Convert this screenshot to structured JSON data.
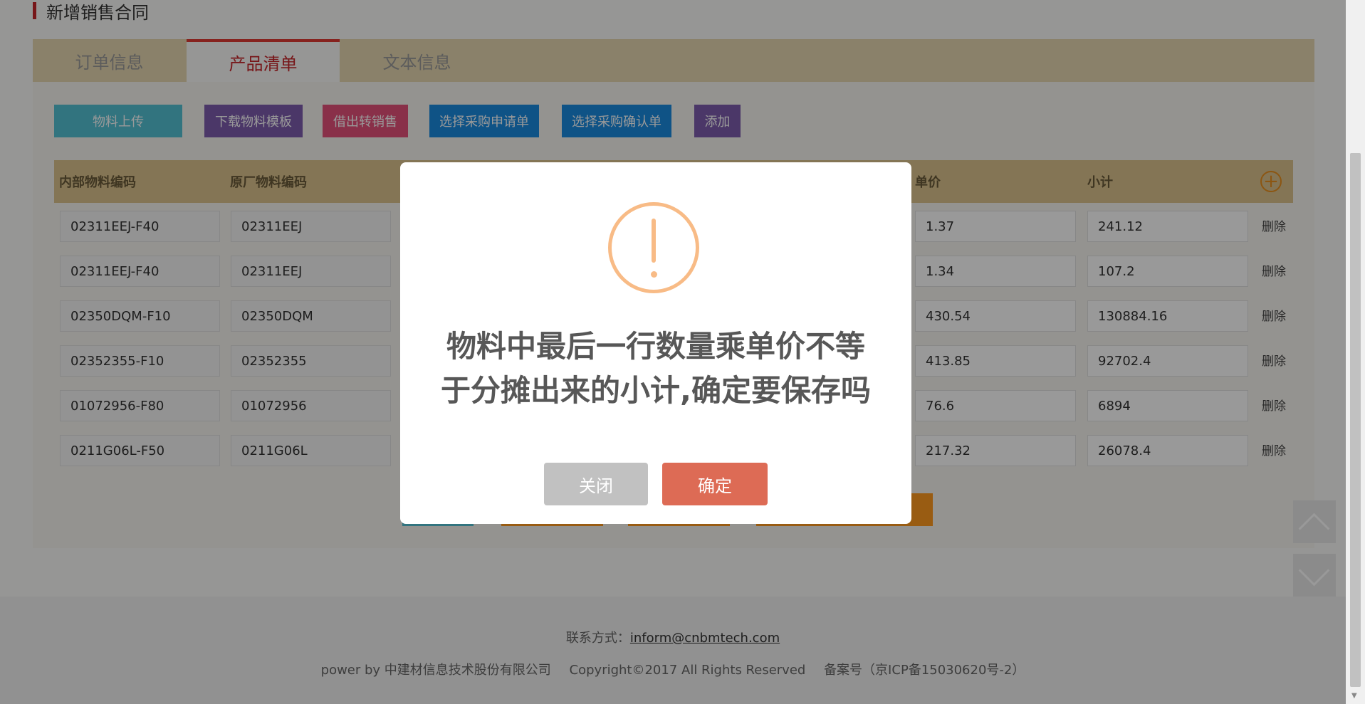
{
  "page": {
    "title": "新增销售合同"
  },
  "tabs": [
    {
      "label": "订单信息",
      "active": false
    },
    {
      "label": "产品清单",
      "active": true
    },
    {
      "label": "文本信息",
      "active": false
    }
  ],
  "toolbar": {
    "buttons": [
      {
        "label": "物料上传",
        "color": "#54c1d4"
      },
      {
        "label": "下载物料模板",
        "color": "#7d5cad"
      },
      {
        "label": "借出转销售",
        "color": "#e5517a"
      },
      {
        "label": "选择采购申请单",
        "color": "#1a8ae0"
      },
      {
        "label": "选择采购确认单",
        "color": "#1a8ae0"
      },
      {
        "label": "添加",
        "color": "#7d5cad"
      }
    ]
  },
  "table": {
    "columns": [
      "内部物料编码",
      "原厂物料编码",
      "单价",
      "小计"
    ],
    "add_icon": "plus-circle-icon",
    "rows": [
      {
        "internal_code": "02311EEJ-F40",
        "original_code": "02311EEJ",
        "unit_price": "1.37",
        "subtotal": "241.12",
        "action": "删除"
      },
      {
        "internal_code": "02311EEJ-F40",
        "original_code": "02311EEJ",
        "unit_price": "1.34",
        "subtotal": "107.2",
        "action": "删除"
      },
      {
        "internal_code": "02350DQM-F10",
        "original_code": "02350DQM",
        "unit_price": "430.54",
        "subtotal": "130884.16",
        "action": "删除"
      },
      {
        "internal_code": "02352355-F10",
        "original_code": "02352355",
        "unit_price": "413.85",
        "subtotal": "92702.4",
        "action": "删除"
      },
      {
        "internal_code": "01072956-F80",
        "original_code": "01072956",
        "unit_price": "76.6",
        "subtotal": "6894",
        "action": "删除"
      },
      {
        "internal_code": "0211G06L-F50",
        "original_code": "0211G06L",
        "unit_price": "217.32",
        "subtotal": "26078.4",
        "action": "删除"
      }
    ]
  },
  "bottom_buttons": {
    "colors": [
      "#54c1d4",
      "#ff9a1f",
      "#ff9a1f",
      "#ff9a1f"
    ]
  },
  "footer": {
    "contact_label": "联系方式：",
    "contact_email": "inform@cnbmtech.com",
    "powered_by": "power by 中建材信息技术股份有限公司",
    "copyright": "Copyright©2017 All Rights Reserved",
    "icp": "备案号（京ICP备15030620号-2）"
  },
  "dialog": {
    "icon": "warning-icon",
    "message_line1": "物料中最后一行数量乘单价不等",
    "message_line2": "于分摊出来的小计,确定要保存吗",
    "close_label": "关闭",
    "confirm_label": "确定"
  }
}
